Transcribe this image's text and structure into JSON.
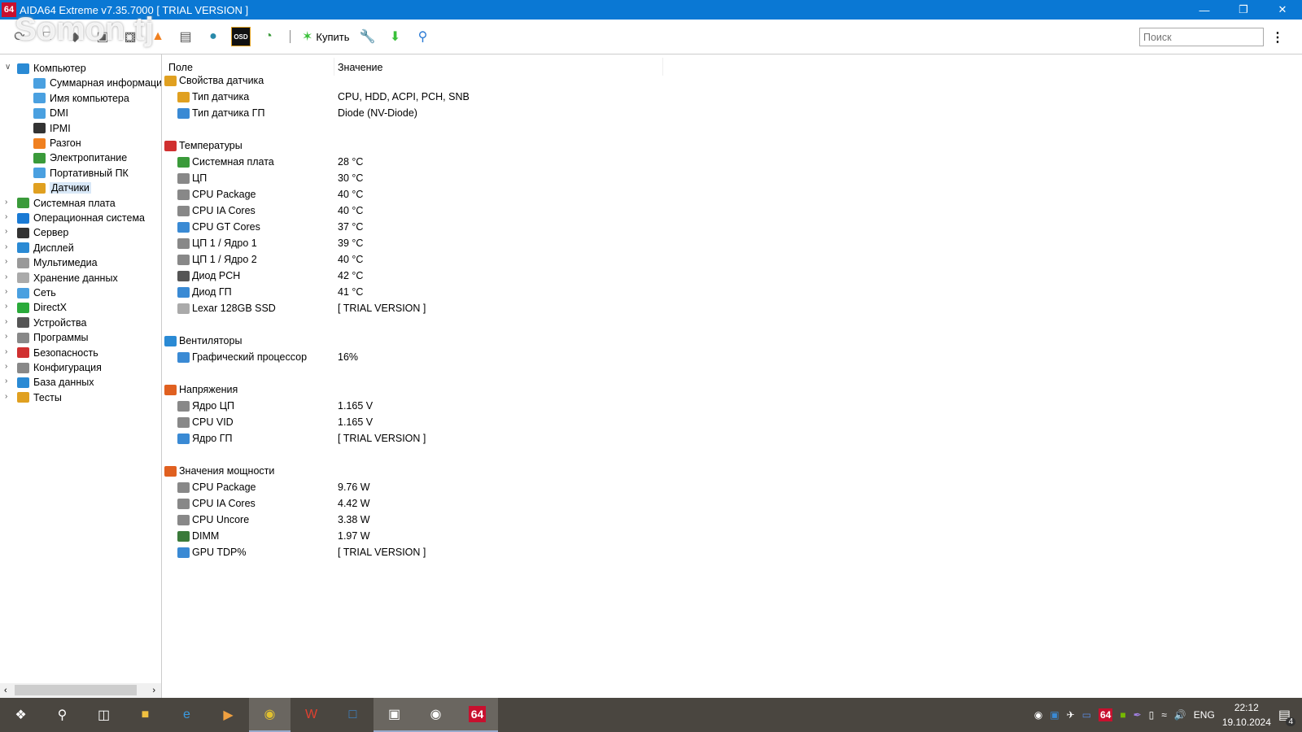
{
  "window": {
    "title": "AIDA64 Extreme v7.35.7000  [ TRIAL VERSION ]",
    "app_icon": "64",
    "watermark": "Somon.tj"
  },
  "toolbar": {
    "buy_label": "Купить",
    "search_placeholder": "Поиск",
    "osd": "OSD"
  },
  "tree": {
    "items": [
      {
        "label": "Компьютер",
        "level": 0,
        "expanded": true,
        "color": "#2a8ad4"
      },
      {
        "label": "Суммарная информация",
        "level": 1,
        "color": "#4aa0e0"
      },
      {
        "label": "Имя компьютера",
        "level": 1,
        "color": "#4aa0e0"
      },
      {
        "label": "DMI",
        "level": 1,
        "color": "#4aa0e0"
      },
      {
        "label": "IPMI",
        "level": 1,
        "color": "#333"
      },
      {
        "label": "Разгон",
        "level": 1,
        "color": "#f08020"
      },
      {
        "label": "Электропитание",
        "level": 1,
        "color": "#3a9a3a"
      },
      {
        "label": "Портативный ПК",
        "level": 1,
        "color": "#4aa0e0"
      },
      {
        "label": "Датчики",
        "level": 1,
        "color": "#e0a020",
        "selected": true
      },
      {
        "label": "Системная плата",
        "level": 0,
        "color": "#3a9a3a"
      },
      {
        "label": "Операционная система",
        "level": 0,
        "color": "#1a7ad4"
      },
      {
        "label": "Сервер",
        "level": 0,
        "color": "#333"
      },
      {
        "label": "Дисплей",
        "level": 0,
        "color": "#2a8ad4"
      },
      {
        "label": "Мультимедиа",
        "level": 0,
        "color": "#999"
      },
      {
        "label": "Хранение данных",
        "level": 0,
        "color": "#aaa"
      },
      {
        "label": "Сеть",
        "level": 0,
        "color": "#4aa0e0"
      },
      {
        "label": "DirectX",
        "level": 0,
        "color": "#2aaa3a"
      },
      {
        "label": "Устройства",
        "level": 0,
        "color": "#555"
      },
      {
        "label": "Программы",
        "level": 0,
        "color": "#888"
      },
      {
        "label": "Безопасность",
        "level": 0,
        "color": "#d03030"
      },
      {
        "label": "Конфигурация",
        "level": 0,
        "color": "#888"
      },
      {
        "label": "База данных",
        "level": 0,
        "color": "#2a8ad4"
      },
      {
        "label": "Тесты",
        "level": 0,
        "color": "#e0a020"
      }
    ]
  },
  "table": {
    "col_field": "Поле",
    "col_value": "Значение",
    "rows": [
      {
        "field": "Свойства датчика",
        "group": true,
        "icon": "sensor-icon"
      },
      {
        "field": "Тип датчика",
        "value": "CPU, HDD, ACPI, PCH, SNB",
        "icon": "sensor-icon"
      },
      {
        "field": "Тип датчика ГП",
        "value": "Diode  (NV-Diode)",
        "icon": "gpu-icon"
      },
      {
        "spacer": true
      },
      {
        "field": "Температуры",
        "group": true,
        "icon": "thermometer-icon"
      },
      {
        "field": "Системная плата",
        "value": "28 °C",
        "icon": "motherboard-icon"
      },
      {
        "field": "ЦП",
        "value": "30 °C",
        "icon": "cpu-icon"
      },
      {
        "field": "CPU Package",
        "value": "40 °C",
        "icon": "cpu-icon"
      },
      {
        "field": "CPU IA Cores",
        "value": "40 °C",
        "icon": "cpu-icon"
      },
      {
        "field": "CPU GT Cores",
        "value": "37 °C",
        "icon": "gpu-icon"
      },
      {
        "field": "ЦП 1 / Ядро 1",
        "value": "39 °C",
        "icon": "cpu-icon"
      },
      {
        "field": "ЦП 1 / Ядро 2",
        "value": "40 °C",
        "icon": "cpu-icon"
      },
      {
        "field": "Диод PCH",
        "value": "42 °C",
        "icon": "chip-icon"
      },
      {
        "field": "Диод ГП",
        "value": "41 °C",
        "icon": "gpu-icon"
      },
      {
        "field": "Lexar 128GB SSD",
        "value": "[ TRIAL VERSION ]",
        "icon": "disk-icon"
      },
      {
        "spacer": true
      },
      {
        "field": "Вентиляторы",
        "group": true,
        "icon": "fan-icon"
      },
      {
        "field": "Графический процессор",
        "value": "16%",
        "icon": "gpu-icon"
      },
      {
        "spacer": true
      },
      {
        "field": "Напряжения",
        "group": true,
        "icon": "voltage-icon"
      },
      {
        "field": "Ядро ЦП",
        "value": "1.165 V",
        "icon": "cpu-icon"
      },
      {
        "field": "CPU VID",
        "value": "1.165 V",
        "icon": "cpu-icon"
      },
      {
        "field": "Ядро ГП",
        "value": "[ TRIAL VERSION ]",
        "icon": "gpu-icon"
      },
      {
        "spacer": true
      },
      {
        "field": "Значения мощности",
        "group": true,
        "icon": "power-icon"
      },
      {
        "field": "CPU Package",
        "value": "9.76 W",
        "icon": "cpu-icon"
      },
      {
        "field": "CPU IA Cores",
        "value": "4.42 W",
        "icon": "cpu-icon"
      },
      {
        "field": "CPU Uncore",
        "value": "3.38 W",
        "icon": "cpu-icon"
      },
      {
        "field": "DIMM",
        "value": "1.97 W",
        "icon": "memory-icon"
      },
      {
        "field": "GPU TDP%",
        "value": "[ TRIAL VERSION ]",
        "icon": "gpu-icon"
      }
    ]
  },
  "taskbar": {
    "aida_label": "64",
    "tray_aida": "64",
    "language": "ENG",
    "time": "22:12",
    "date": "19.10.2024",
    "notifications": "4"
  }
}
